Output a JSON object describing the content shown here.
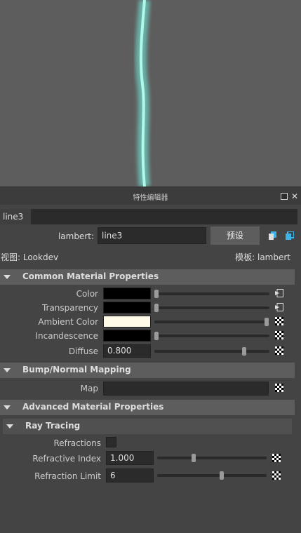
{
  "panel": {
    "title": "特性编辑器",
    "tab_label": "line3",
    "type_label": "lambert:",
    "name_value": "line3",
    "preset_label": "预设",
    "view_label": "视图: Lookdev",
    "template_label": "模板: lambert"
  },
  "sections": {
    "common": "Common Material Properties",
    "bump": "Bump/Normal Mapping",
    "advanced": "Advanced Material Properties",
    "raytracing": "Ray Tracing"
  },
  "attrs": {
    "color": {
      "label": "Color",
      "swatch": "#000000",
      "slider": 0.0
    },
    "transparency": {
      "label": "Transparency",
      "swatch": "#000000",
      "slider": 0.0
    },
    "ambient": {
      "label": "Ambient Color",
      "swatch": "#fffbe8",
      "slider": 1.0
    },
    "incandescence": {
      "label": "Incandescence",
      "swatch": "#000000",
      "slider": 0.0
    },
    "diffuse": {
      "label": "Diffuse",
      "value": "0.800",
      "slider": 0.8
    },
    "map": {
      "label": "Map"
    },
    "refractions": {
      "label": "Refractions",
      "checked": false
    },
    "refractive_index": {
      "label": "Refractive Index",
      "value": "1.000",
      "slider": 0.33
    },
    "refraction_limit": {
      "label": "Refraction Limit",
      "value": "6",
      "slider": 0.6
    }
  },
  "colors": {
    "accent_line": "#7fe0d0"
  }
}
